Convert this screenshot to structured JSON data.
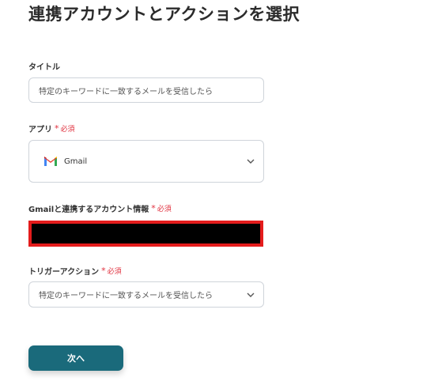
{
  "page": {
    "title": "連携アカウントとアクションを選択"
  },
  "title_field": {
    "label": "タイトル",
    "value": "特定のキーワードに一致するメールを受信したら"
  },
  "app_field": {
    "label": "アプリ",
    "required_mark": "*",
    "required_text": "必須",
    "value": "Gmail",
    "icon": "gmail-logo-icon"
  },
  "account_field": {
    "label": "Gmailと連携するアカウント情報",
    "required_mark": "*",
    "required_text": "必須"
  },
  "trigger_field": {
    "label": "トリガーアクション",
    "required_mark": "*",
    "required_text": "必須",
    "value": "特定のキーワードに一致するメールを受信したら"
  },
  "actions": {
    "next_label": "次へ"
  },
  "colors": {
    "primary_button": "#1a6a7b",
    "required": "#e0303e",
    "redaction_border": "#e41c1c"
  }
}
